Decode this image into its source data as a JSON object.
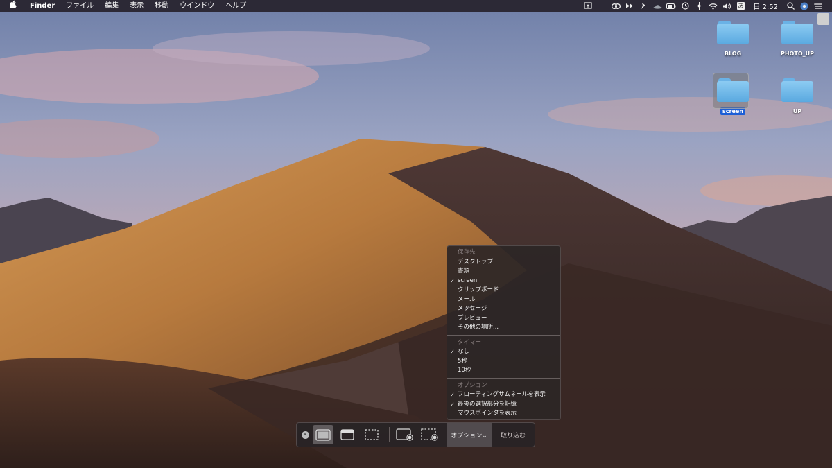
{
  "menubar": {
    "apple": "",
    "app_name": "Finder",
    "menus": [
      "ファイル",
      "編集",
      "表示",
      "移動",
      "ウインドウ",
      "ヘルプ"
    ],
    "ime_label": "あ",
    "clock": "日 2:52"
  },
  "desktop": {
    "icons": [
      {
        "label": "BLOG",
        "selected": false
      },
      {
        "label": "PHOTO_UP",
        "selected": false
      },
      {
        "label": "screen",
        "selected": true
      },
      {
        "label": "UP",
        "selected": false
      }
    ]
  },
  "options_menu": {
    "save_header": "保存先",
    "save_items": [
      {
        "label": "デスクトップ",
        "checked": false
      },
      {
        "label": "書類",
        "checked": false
      },
      {
        "label": "screen",
        "checked": true
      },
      {
        "label": "クリップボード",
        "checked": false
      },
      {
        "label": "メール",
        "checked": false
      },
      {
        "label": "メッセージ",
        "checked": false
      },
      {
        "label": "プレビュー",
        "checked": false
      },
      {
        "label": "その他の場所...",
        "checked": false
      }
    ],
    "timer_header": "タイマー",
    "timer_items": [
      {
        "label": "なし",
        "checked": true
      },
      {
        "label": "5秒",
        "checked": false
      },
      {
        "label": "10秒",
        "checked": false
      }
    ],
    "options_header": "オプション",
    "option_items": [
      {
        "label": "フローティングサムネールを表示",
        "checked": true
      },
      {
        "label": "最後の選択部分を記憶",
        "checked": true
      },
      {
        "label": "マウスポインタを表示",
        "checked": false
      }
    ],
    "check_glyph": "✓"
  },
  "toolbar": {
    "close_glyph": "✕",
    "options_label": "オプション⌄",
    "capture_label": "取り込む"
  },
  "colors": {
    "selection": "#1d5fd6",
    "folder": "#5aa9e0"
  }
}
